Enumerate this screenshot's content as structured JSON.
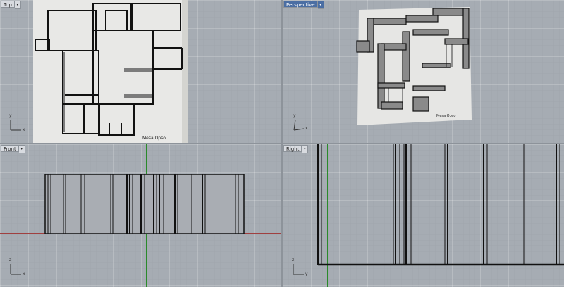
{
  "viewports": {
    "top": {
      "label": "Top",
      "axis_x": "x",
      "axis_y": "y",
      "sketch_text": "Mesa Opso"
    },
    "perspective": {
      "label": "Perspective",
      "axis_x": "x",
      "axis_y": "y",
      "sketch_text": "Mesa Opso"
    },
    "front": {
      "label": "Front",
      "axis_x": "x",
      "axis_y": "z"
    },
    "right": {
      "label": "Right",
      "axis_x": "y",
      "axis_y": "z"
    }
  },
  "dropdown_glyph": "▾",
  "colors": {
    "viewport_bg": "#a6acb3",
    "active_tab": "#4b6ea3",
    "x_axis": "#9a2a2a",
    "y_axis": "#2a8a2a",
    "linework": "#111111"
  }
}
